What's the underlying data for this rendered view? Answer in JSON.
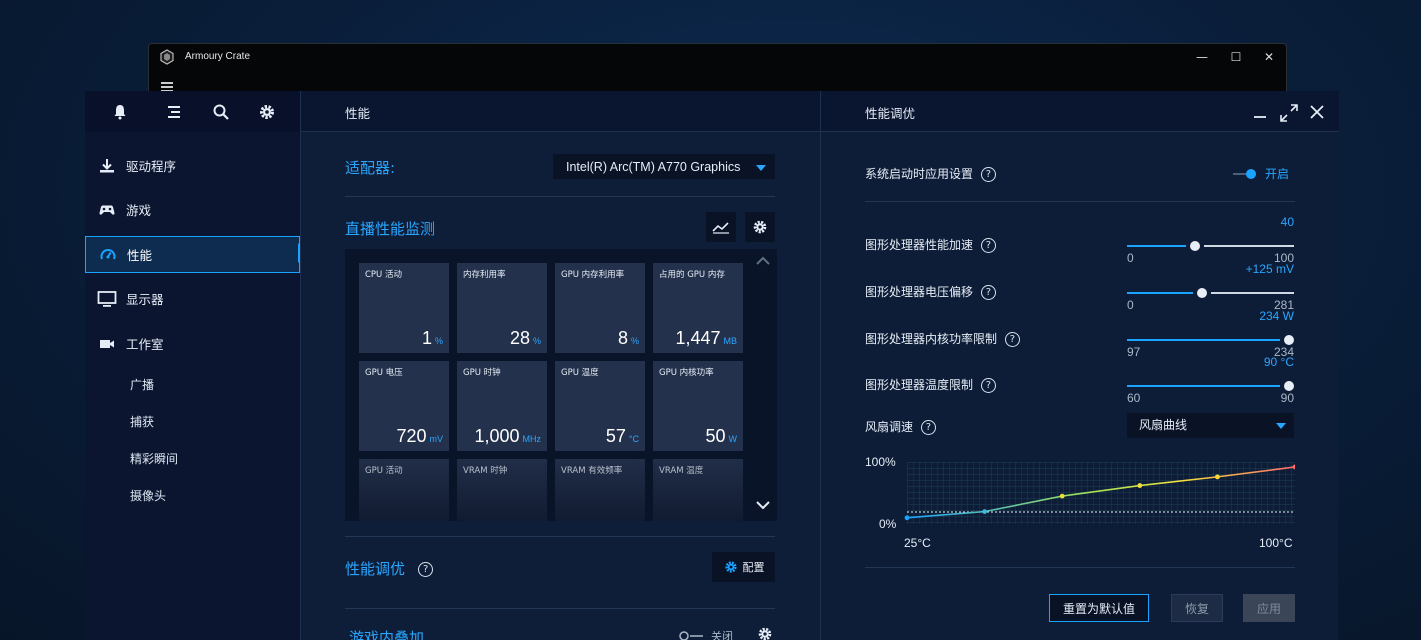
{
  "window": {
    "title": "Armoury Crate",
    "controls": [
      "—",
      "☐",
      "✕"
    ]
  },
  "sidebar": {
    "items": [
      {
        "label": "驱动程序",
        "icon": "download-icon"
      },
      {
        "label": "游戏",
        "icon": "gamepad-icon"
      },
      {
        "label": "性能",
        "icon": "gauge-icon",
        "active": true
      },
      {
        "label": "显示器",
        "icon": "monitor-icon"
      },
      {
        "label": "工作室",
        "icon": "camera-icon"
      }
    ],
    "sub_items": [
      "广播",
      "捕获",
      "精彩瞬间",
      "摄像头"
    ]
  },
  "middle": {
    "title": "性能",
    "adapter_label": "适配器:",
    "adapter_value": "Intel(R) Arc(TM) A770 Graphics",
    "monitor_title": "直播性能监测",
    "tiles": [
      {
        "label": "CPU 活动",
        "value": "1",
        "unit": "%"
      },
      {
        "label": "内存利用率",
        "value": "28",
        "unit": "%"
      },
      {
        "label": "GPU 内存利用率",
        "value": "8",
        "unit": "%"
      },
      {
        "label": "占用的 GPU 内存",
        "value": "1,447",
        "unit": "MB"
      },
      {
        "label": "GPU 电压",
        "value": "720",
        "unit": "mV"
      },
      {
        "label": "GPU 时钟",
        "value": "1,000",
        "unit": "MHz"
      },
      {
        "label": "GPU 温度",
        "value": "57",
        "unit": "°C"
      },
      {
        "label": "GPU 内核功率",
        "value": "50",
        "unit": "W"
      },
      {
        "label": "GPU 活动",
        "value": "",
        "unit": ""
      },
      {
        "label": "VRAM 时钟",
        "value": "",
        "unit": ""
      },
      {
        "label": "VRAM 有效频率",
        "value": "",
        "unit": ""
      },
      {
        "label": "VRAM 温度",
        "value": "",
        "unit": ""
      }
    ],
    "tuning_title": "性能调优",
    "config_label": "配置",
    "overlay_title": "游戏内叠加",
    "overlay_toggle_label": "关闭"
  },
  "right": {
    "title": "性能调优",
    "startup_label": "系统启动时应用设置",
    "startup_state": "开启",
    "sliders": [
      {
        "label": "图形处理器性能加速",
        "current": "40",
        "min": "0",
        "max": "100",
        "fraction": 0.4
      },
      {
        "label": "图形处理器电压偏移",
        "current": "+125 mV",
        "min": "0",
        "max": "281",
        "fraction": 0.445
      },
      {
        "label": "图形处理器内核功率限制",
        "current": "234 W",
        "min": "97",
        "max": "234",
        "fraction": 1.0
      },
      {
        "label": "图形处理器温度限制",
        "current": "90 °C",
        "min": "60",
        "max": "90",
        "fraction": 1.0
      }
    ],
    "fan_label": "风扇调速",
    "fan_mode": "风扇曲线",
    "fan_chart": {
      "y_top": "100%",
      "y_bottom": "0%",
      "x_left": "25°C",
      "x_right": "100°C",
      "points": [
        [
          25,
          10
        ],
        [
          40,
          20
        ],
        [
          55,
          45
        ],
        [
          70,
          62
        ],
        [
          85,
          76
        ],
        [
          100,
          92
        ]
      ]
    },
    "buttons": {
      "reset": "重置为默认值",
      "restore": "恢复",
      "apply": "应用"
    }
  },
  "colors": {
    "accent": "#1aa3ff",
    "panel": "#0f1e38",
    "tile": "#24314c"
  }
}
